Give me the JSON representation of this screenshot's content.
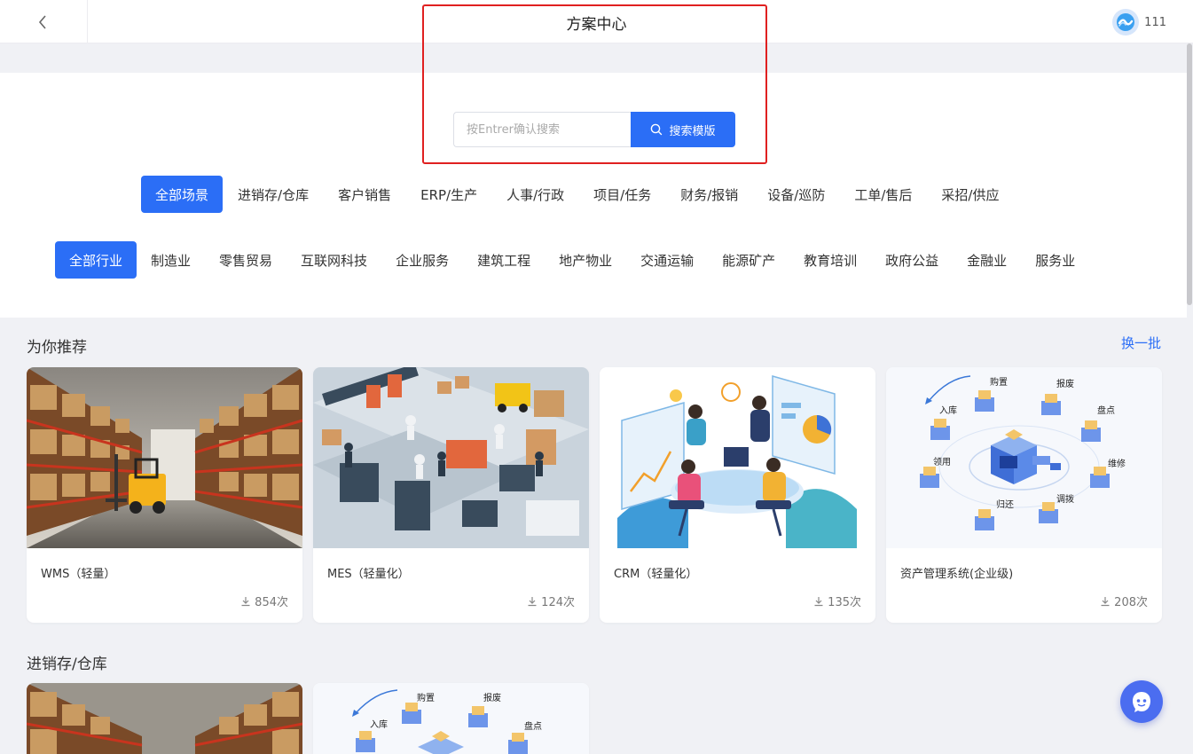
{
  "header": {
    "title": "方案中心",
    "username": "111"
  },
  "search": {
    "placeholder": "按Entrer确认搜索",
    "button_label": "搜索模版"
  },
  "scene_tabs": [
    {
      "label": "全部场景",
      "active": true
    },
    {
      "label": "进销存/仓库",
      "active": false
    },
    {
      "label": "客户销售",
      "active": false
    },
    {
      "label": "ERP/生产",
      "active": false
    },
    {
      "label": "人事/行政",
      "active": false
    },
    {
      "label": "项目/任务",
      "active": false
    },
    {
      "label": "财务/报销",
      "active": false
    },
    {
      "label": "设备/巡防",
      "active": false
    },
    {
      "label": "工单/售后",
      "active": false
    },
    {
      "label": "采招/供应",
      "active": false
    }
  ],
  "industry_tabs": [
    {
      "label": "全部行业",
      "active": true
    },
    {
      "label": "制造业",
      "active": false
    },
    {
      "label": "零售贸易",
      "active": false
    },
    {
      "label": "互联网科技",
      "active": false
    },
    {
      "label": "企业服务",
      "active": false
    },
    {
      "label": "建筑工程",
      "active": false
    },
    {
      "label": "地产物业",
      "active": false
    },
    {
      "label": "交通运输",
      "active": false
    },
    {
      "label": "能源矿产",
      "active": false
    },
    {
      "label": "教育培训",
      "active": false
    },
    {
      "label": "政府公益",
      "active": false
    },
    {
      "label": "金融业",
      "active": false
    },
    {
      "label": "服务业",
      "active": false
    }
  ],
  "recommend": {
    "title": "为你推荐",
    "refresh_label": "换一批",
    "cards": [
      {
        "title": "WMS（轻量）",
        "downloads": "854次",
        "image": "warehouse-photo"
      },
      {
        "title": "MES（轻量化）",
        "downloads": "124次",
        "image": "factory-isometric-illustration"
      },
      {
        "title": "CRM（轻量化）",
        "downloads": "135次",
        "image": "team-meeting-illustration"
      },
      {
        "title": "资产管理系统(企业级)",
        "downloads": "208次",
        "image": "asset-lifecycle-diagram"
      }
    ]
  },
  "asset_diagram_labels": [
    "入库",
    "购置",
    "报废",
    "盘点",
    "领用",
    "维修",
    "归还",
    "调拨"
  ],
  "inventory_section": {
    "title": "进销存/仓库"
  },
  "colors": {
    "accent": "#2b6ef6",
    "highlight_border": "#e02020",
    "fab": "#4b6df0"
  },
  "icons": [
    "back-icon",
    "avatar-logo-icon",
    "search-icon",
    "download-icon",
    "support-chat-icon"
  ]
}
